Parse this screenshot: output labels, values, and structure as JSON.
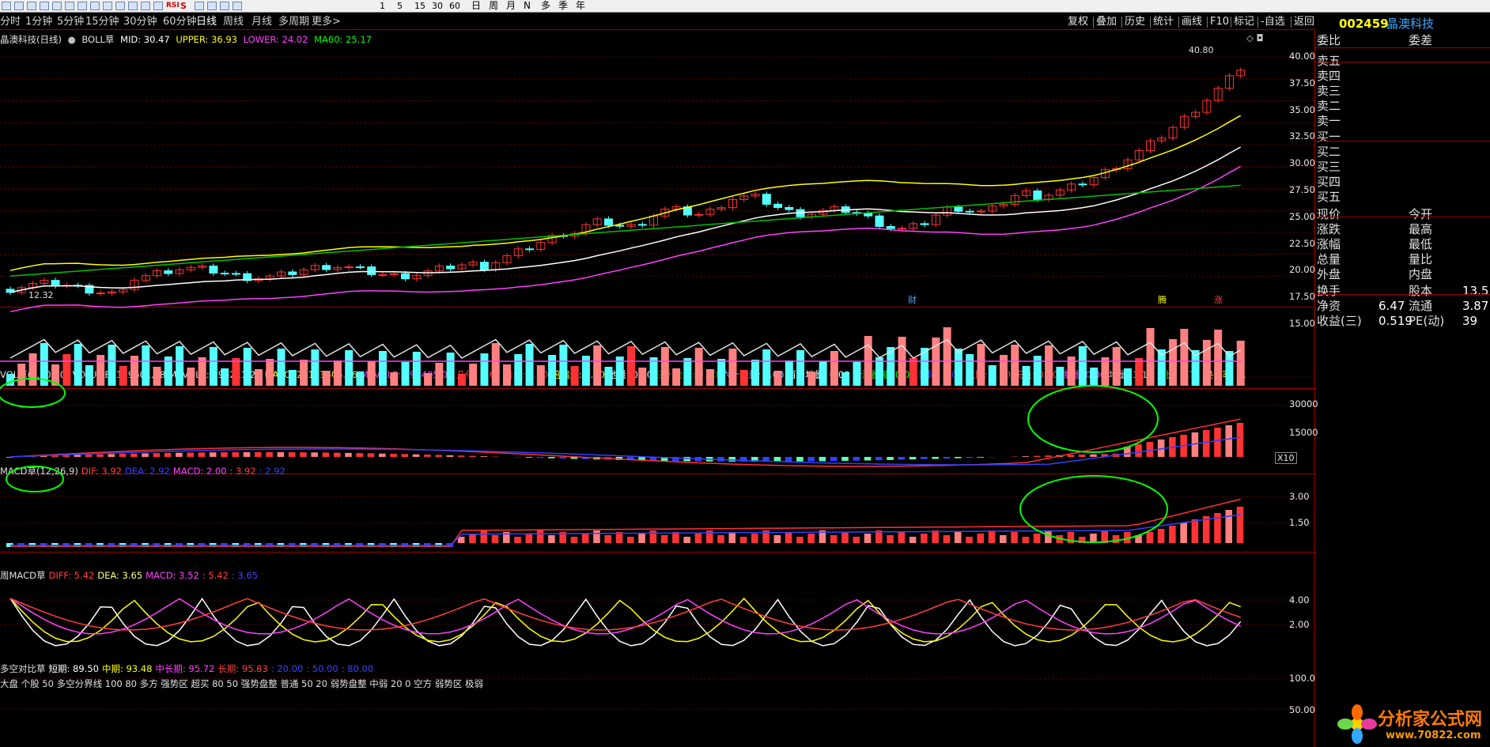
{
  "toolbar": {
    "icons": [
      "window-icon",
      "arrow-up-icon",
      "arrow-down-icon",
      "line-tool-icon",
      "chart-tool-icon",
      "f9-icon",
      "f10-icon",
      "f11-icon",
      "f12-icon",
      "grid-icon",
      "list-icon",
      "zoom-icon",
      "candle-icon",
      "rsi-icon",
      "s-icon",
      "move-icon",
      "pencil-icon",
      "save-icon",
      "copy-icon"
    ],
    "rsi_label": "RSI",
    "s_label": "S",
    "numbers": [
      "1",
      "5",
      "15",
      "30",
      "60"
    ],
    "period_chars": [
      "日",
      "周",
      "月",
      "N",
      "多",
      "季",
      "年"
    ]
  },
  "periods": [
    "分时",
    "1分钟",
    "5分钟",
    "15分钟",
    "30分钟",
    "60分钟",
    "日线",
    "周线",
    "月线",
    "多周期",
    "更多"
  ],
  "active_period": "日线",
  "right_buttons": [
    "复权",
    "叠加",
    "历史",
    "统计",
    "画线",
    "F10",
    "标记",
    "-自选",
    "返回"
  ],
  "stock": {
    "code": "002459",
    "name": "晶澳科技"
  },
  "main_legend": {
    "title": "晶澳科技(日线)",
    "indicator": "BOLL草",
    "mid": "MID: 30.47",
    "upper": "UPPER: 36.93",
    "lower": "LOWER: 24.02",
    "ma60": "MA60: 25.17"
  },
  "price_axis": [
    "40.00",
    "37.50",
    "35.00",
    "32.50",
    "30.00",
    "27.50",
    "25.00",
    "22.50",
    "20.00",
    "17.50",
    "15.00"
  ],
  "price_markers": {
    "high": "40.80",
    "low": "12.32"
  },
  "event_markers": [
    "财",
    "腾",
    "涨"
  ],
  "vol_legend": [
    {
      "t": "VOL草(5,60,60)",
      "c": "#e0e0e0"
    },
    {
      "t": "VOLUME: 159601.88",
      "c": "#e0e0e0"
    },
    {
      "t": "MAVOL1: 196211.25",
      "c": "#e0e0e0"
    },
    {
      "t": "MAVOL2: 193405.06",
      "c": "#ffff00"
    },
    {
      "t": "MAVOL3: 193405.06",
      "c": "#ff40ff"
    },
    {
      "t": "几倍: 0.67",
      "c": "#ff4040"
    },
    {
      "t": "倍量: 0.00",
      "c": "#ff4040"
    },
    {
      "t": "倍缩量: 0.00",
      "c": "#ffff00"
    },
    {
      "t": "地量: 0.00",
      "c": "#ffffff"
    },
    {
      "t": "三十地量: 0.00",
      "c": "#008000"
    },
    {
      "t": "六十地量: 0.00",
      "c": "#80c0ff"
    },
    {
      "t": "百日地量: 0.00",
      "c": "#ffffff"
    },
    {
      "t": "价涨量缩: 0.00",
      "c": "#00ff00"
    },
    {
      "t": "阴阳: 0.00",
      "c": "#4040ff"
    },
    {
      "t": "红阳: 0.00",
      "c": "#ff4040"
    },
    {
      "t": "天量: 0.00",
      "c": "#ff4040"
    },
    {
      "t": "爆量: 0.00",
      "c": "#ff40ff"
    },
    {
      "t": "堆量: 3.10",
      "c": "#c0c0c0"
    },
    {
      "t": "量比: 0.71",
      "c": "#00ff00"
    },
    {
      "t": "换手率: 4.",
      "c": "#ffff00"
    }
  ],
  "vol_axis": [
    "30000",
    "15000"
  ],
  "vol_unit": "X10",
  "macd1_legend": [
    {
      "t": "MACD草(12,26,9)",
      "c": "#e0e0e0"
    },
    {
      "t": "DIF: 3.92",
      "c": "#ff4040"
    },
    {
      "t": "DEA: 2.92",
      "c": "#4040ff"
    },
    {
      "t": "MACD: 2.00",
      "c": "#ff40ff"
    },
    {
      "t": ": 3.92",
      "c": "#ff4040"
    },
    {
      "t": ": 2.92",
      "c": "#4040ff"
    }
  ],
  "macd1_axis": [
    "3.00",
    "1.50"
  ],
  "macd2_legend": [
    {
      "t": "周MACD草",
      "c": "#e0e0e0"
    },
    {
      "t": "DIFF: 5.42",
      "c": "#ff4040"
    },
    {
      "t": "DEA: 3.65",
      "c": "#ffff80"
    },
    {
      "t": "MACD: 3.52",
      "c": "#ff40ff"
    },
    {
      "t": ": 5.42",
      "c": "#ff4040"
    },
    {
      "t": ": 3.65",
      "c": "#4040ff"
    }
  ],
  "macd2_axis": [
    "4.00",
    "2.00"
  ],
  "dk_legend": [
    {
      "t": "多空对比草",
      "c": "#e0e0e0"
    },
    {
      "t": "短期: 89.50",
      "c": "#ffffff"
    },
    {
      "t": "中期: 93.48",
      "c": "#ffff00"
    },
    {
      "t": "中长期: 95.72",
      "c": "#ff40ff"
    },
    {
      "t": "长期: 95.83",
      "c": "#ff4040"
    },
    {
      "t": ": 20.00",
      "c": "#4040ff"
    },
    {
      "t": ": 50.00",
      "c": "#4040ff"
    },
    {
      "t": ": 80.00",
      "c": "#4040ff"
    }
  ],
  "dk_note": "大盘 个股 50 多空分界线 100 80 多方 强势区 超买 80 50 强势盘整 普通 50 20 弱势盘整 中弱 20 0 空方 弱势区 极弱",
  "dk_axis": [
    "100.0",
    "50.00"
  ],
  "order_book": {
    "header": [
      "委比",
      "委差"
    ],
    "sells": [
      "卖五",
      "卖四",
      "卖三",
      "卖二",
      "卖一"
    ],
    "buys": [
      "买一",
      "买二",
      "买三",
      "买四",
      "买五"
    ],
    "quote_left": [
      "现价",
      "涨跌",
      "涨幅",
      "总量",
      "外盘"
    ],
    "quote_right": [
      "今开",
      "最高",
      "最低",
      "量比",
      "内盘"
    ],
    "stats": [
      {
        "l": "换手",
        "v": "",
        "l2": "股本",
        "v2": "13.5"
      },
      {
        "l": "净资",
        "v": "6.47",
        "l2": "流通",
        "v2": "3.87"
      },
      {
        "l": "收益(三)",
        "v": "0.519",
        "l2": "PE(动)",
        "v2": "39"
      }
    ]
  },
  "watermark": {
    "title": "分析家公式网",
    "url": "www.70822.com"
  },
  "colors": {
    "up": "#ff3333",
    "down": "#54ffff",
    "grid": "#a00000",
    "code": "#ffff00",
    "name": "#3fa9ff"
  }
}
